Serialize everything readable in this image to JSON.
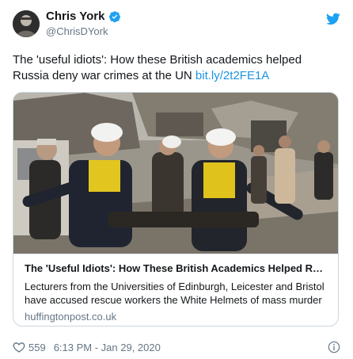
{
  "author": {
    "display_name": "Chris York",
    "handle": "@ChrisDYork",
    "verified": true
  },
  "tweet": {
    "text": "The 'useful idiots': How these British academics helped Russia deny war crimes at the UN ",
    "link": "bit.ly/2t2FE1A"
  },
  "card": {
    "title": "The 'Useful Idiots': How These British Academics Helped Rus...",
    "description": "Lecturers from the Universities of Edinburgh, Leicester and Bristol have accused rescue workers the White Helmets of mass murder in",
    "domain": "huffingtonpost.co.uk"
  },
  "footer": {
    "likes": "559",
    "timestamp": "6:13 PM - Jan 29, 2020"
  },
  "icons": {
    "avatar": "profile-photo",
    "verified": "verified-badge-icon",
    "logo": "twitter-bird-icon",
    "like": "heart-icon",
    "info": "info-icon"
  },
  "colors": {
    "link": "#1b95e0",
    "text": "#14171a",
    "muted": "#657786",
    "border": "#ccd6dd",
    "verified": "#1da1f2"
  }
}
